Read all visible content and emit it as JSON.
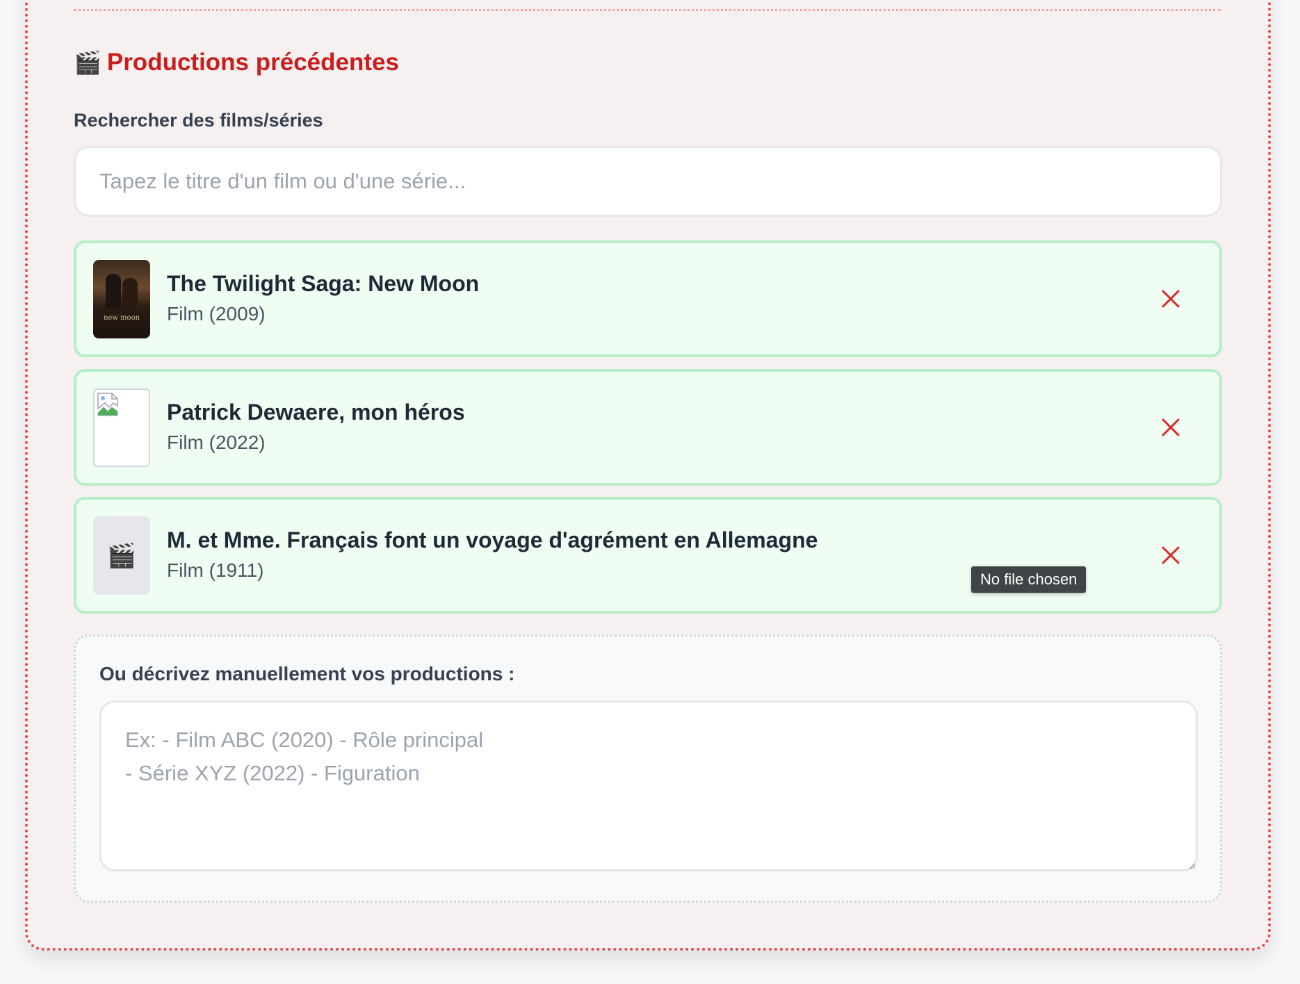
{
  "section": {
    "title": "Productions précédentes",
    "title_icon": "clapperboard-icon"
  },
  "search": {
    "label": "Rechercher des films/séries",
    "placeholder": "Tapez le titre d'un film ou d'une série...",
    "value": ""
  },
  "productions": [
    {
      "title": "The Twilight Saga: New Moon",
      "subtitle": "Film (2009)",
      "poster": "poster-image",
      "poster_text": "new moon"
    },
    {
      "title": "Patrick Dewaere, mon héros",
      "subtitle": "Film (2022)",
      "poster": "broken-image-icon"
    },
    {
      "title": "M. et Mme. Français font un voyage d'agrément en Allemagne",
      "subtitle": "Film (1911)",
      "poster": "clapperboard-icon"
    }
  ],
  "tooltip": {
    "text": "No file chosen"
  },
  "manual": {
    "label": "Ou décrivez manuellement vos productions :",
    "placeholder": "Ex: - Film ABC (2020) - Rôle principal\n- Série XYZ (2022) - Figuration",
    "value": ""
  },
  "colors": {
    "accent": "#c81e1e",
    "card_border": "#e5484d",
    "item_bg": "#effdf3",
    "item_border": "#b7eec9",
    "remove": "#dc2626"
  }
}
